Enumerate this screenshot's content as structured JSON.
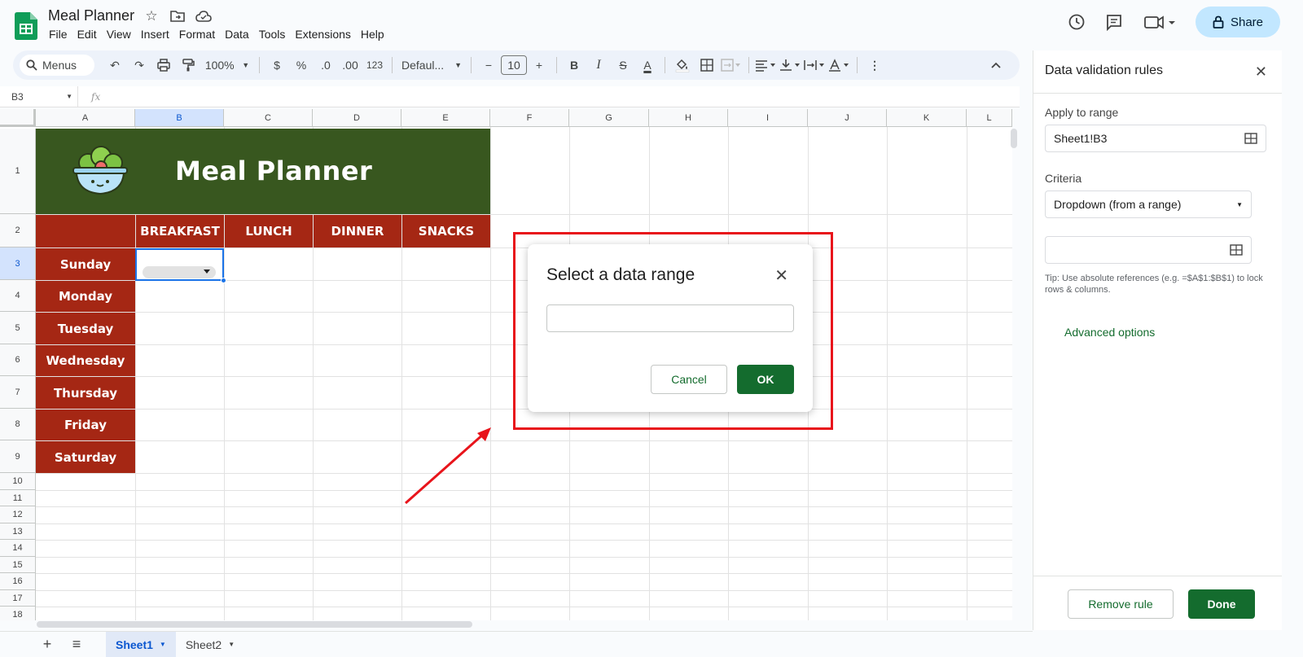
{
  "app": {
    "doc_title": "Meal Planner",
    "menus": [
      "File",
      "Edit",
      "View",
      "Insert",
      "Format",
      "Data",
      "Tools",
      "Extensions",
      "Help"
    ],
    "share_label": "Share"
  },
  "toolbar": {
    "search_label": "Menus",
    "zoom": "100%",
    "currency": "$",
    "percent": "%",
    "dec_decrease": ".0",
    "dec_increase": ".00",
    "number_format": "123",
    "font": "Defaul...",
    "font_size": "10"
  },
  "formula_bar": {
    "name_box": "B3",
    "fx": "fx"
  },
  "grid": {
    "columns": [
      "A",
      "B",
      "C",
      "D",
      "E",
      "F",
      "G",
      "H",
      "I",
      "J",
      "K",
      "L"
    ],
    "rows": [
      "1",
      "2",
      "3",
      "4",
      "5",
      "6",
      "7",
      "8",
      "9",
      "10",
      "11",
      "12",
      "13",
      "14",
      "15",
      "16",
      "17",
      "18"
    ],
    "banner_title": "Meal Planner",
    "meal_headers": [
      "BREAKFAST",
      "LUNCH",
      "DINNER",
      "SNACKS"
    ],
    "days": [
      "Sunday",
      "Monday",
      "Tuesday",
      "Wednesday",
      "Thursday",
      "Friday",
      "Saturday"
    ],
    "selected_cell": "B3",
    "colors": {
      "banner": "#38571f",
      "day_cells": "#a52714",
      "selection": "#1a73e8"
    }
  },
  "sheet_tabs": [
    {
      "label": "Sheet1",
      "active": true
    },
    {
      "label": "Sheet2",
      "active": false
    }
  ],
  "panel": {
    "title": "Data validation rules",
    "apply_label": "Apply to range",
    "apply_value": "Sheet1!B3",
    "criteria_label": "Criteria",
    "criteria_value": "Dropdown (from a range)",
    "range_value": "",
    "tip": "Tip: Use absolute references (e.g. =$A$1:$B$1) to lock rows & columns.",
    "advanced": "Advanced options",
    "remove_label": "Remove rule",
    "done_label": "Done",
    "accent": "#146c2e"
  },
  "dialog": {
    "title": "Select a data range",
    "input_value": "",
    "cancel_label": "Cancel",
    "ok_label": "OK"
  },
  "annotation": {
    "color": "#e8141b"
  }
}
